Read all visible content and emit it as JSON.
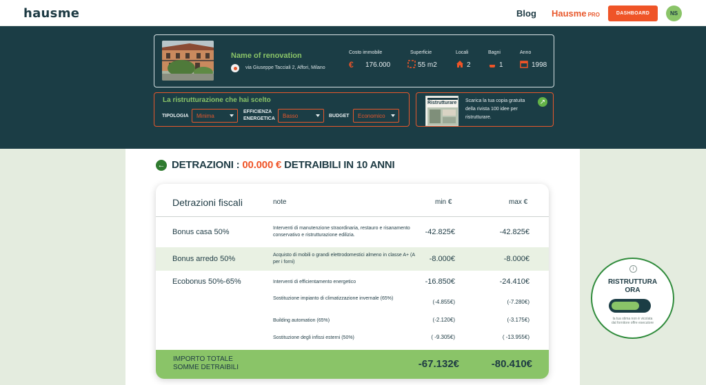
{
  "nav": {
    "logo": "hausme",
    "blog": "Blog",
    "pro_brand": "Hausme",
    "pro_suffix": "PRO",
    "dashboard": "DASHBOARD",
    "avatar_initials": "NS"
  },
  "property": {
    "name": "Name of renovation",
    "address": "via Giuseppe Tacciali 2, Affori, Milano",
    "stats": [
      {
        "label": "Costo immobile",
        "icon": "euro-icon",
        "value": "176.000"
      },
      {
        "label": "Superficie",
        "icon": "area-icon",
        "value": "55 m2"
      },
      {
        "label": "Locali",
        "icon": "house-icon",
        "value": "2"
      },
      {
        "label": "Bagni",
        "icon": "bath-icon",
        "value": "1"
      },
      {
        "label": "Anno",
        "icon": "calendar-icon",
        "value": "1998"
      }
    ]
  },
  "renovation": {
    "title": "La ristrutturazione che hai scelto",
    "tipologia_label": "TIPOLOGIA",
    "tipologia_value": "Minima",
    "efficienza_label_1": "EFFICIENZA",
    "efficienza_label_2": "ENERGETICA",
    "efficienza_value": "Basso",
    "budget_label": "BUDGET",
    "budget_value": "Economico"
  },
  "magazine": {
    "cover_title": "Ristrutturare",
    "text": "Scarica la tua copia gratuita della rivista 100 idee per ristrutturare."
  },
  "heading": {
    "prefix": "DETRAZIONI :",
    "amount": "00.000 €",
    "suffix": "DETRAIBILI IN 10 ANNI"
  },
  "table": {
    "headers": {
      "name": "Detrazioni fiscali",
      "note": "note",
      "min": "min €",
      "max": "max €"
    },
    "rows": [
      {
        "name": "Bonus casa 50%",
        "note": "Interventi di manutenzione straordinaria, restauro e risanamento conservativo e ristrutturazione edilizia.",
        "min": "-42.825€",
        "max": "-42.825€"
      },
      {
        "name": "Bonus arredo 50%",
        "note": "Acquisto di mobili o grandi elettrodomestici almeno in classe A+ (A per i forni)",
        "min": "-8.000€",
        "max": "-8.000€"
      },
      {
        "name": "Ecobonus 50%-65%",
        "note": "Interventi di efficientamento energetico",
        "min": "-16.850€",
        "max": "-24.410€"
      }
    ],
    "subrows": [
      {
        "note": "Sostituzione impianto di climatizzazione invernale (65%)",
        "min": "(-4.855€)",
        "max": "(-7.280€)"
      },
      {
        "note": "Building automation (65%)",
        "min": "(-2.120€)",
        "max": "(-3.175€)"
      },
      {
        "note": "Sostituzione degli infissi esterni (50%)",
        "min": "( -9.305€)",
        "max": "( -13.955€)"
      }
    ],
    "total_label_1": "IMPORTO TOTALE",
    "total_label_2": "SOMME DETRAIBILI",
    "total_min": "-67.132€",
    "total_max": "-80.410€"
  },
  "cta": {
    "info": "i",
    "title_1": "RISTRUTTURA",
    "title_2": "ORA",
    "note": "la tua stima non è vicolata dal fornitore offre esecutore"
  },
  "colors": {
    "dark": "#1b3d45",
    "accent": "#ef5427",
    "green": "#8ac468",
    "text": "#1d3a43"
  }
}
